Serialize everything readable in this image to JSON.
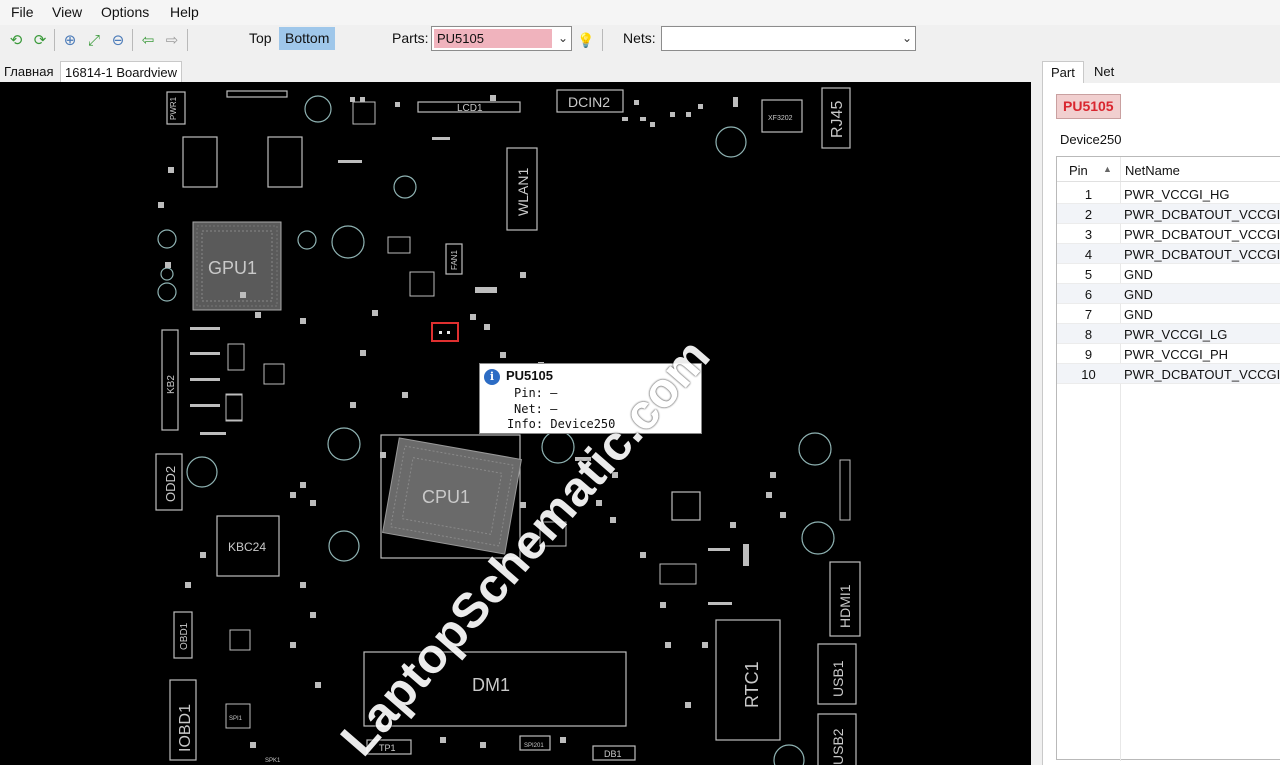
{
  "menu": [
    "File",
    "View",
    "Options",
    "Help"
  ],
  "toolbar": {
    "icons": [
      "rotate-left-icon",
      "rotate-right-icon",
      "zoom-in-icon",
      "zoom-fit-icon",
      "zoom-out-icon",
      "back-icon",
      "forward-icon"
    ],
    "top_label": "Top",
    "bottom_label": "Bottom",
    "parts_label": "Parts:",
    "parts_value": "PU5105",
    "nets_label": "Nets:",
    "nets_value": ""
  },
  "tabs": [
    "Главная",
    "16814-1 Boardview"
  ],
  "board": {
    "labels": [
      "PWR1",
      "LCD1",
      "DCIN2",
      "XF3202",
      "RJ45",
      "WLAN1",
      "GPU1",
      "FAN1",
      "KB2",
      "ODD2",
      "CPU1",
      "KBC24",
      "OBD1",
      "IOBD1",
      "DM1",
      "RTC1",
      "HDMI1",
      "USB1",
      "USB2",
      "TP1",
      "DB1",
      "SPI201",
      "SPK1",
      "SPI1"
    ],
    "selected_part": "PU5105"
  },
  "tooltip": {
    "title": "PU5105",
    "pin": "Pin: —",
    "net": "Net: —",
    "info": "Info: Device250"
  },
  "watermark": "LaptopSchematic.com",
  "panel": {
    "tabs": [
      "Part",
      "Net"
    ],
    "part_name": "PU5105",
    "device": "Device250",
    "headers": {
      "pin": "Pin",
      "net": "NetName"
    },
    "rows": [
      {
        "pin": "1",
        "net": "PWR_VCCGI_HG"
      },
      {
        "pin": "2",
        "net": "PWR_DCBATOUT_VCCGI"
      },
      {
        "pin": "3",
        "net": "PWR_DCBATOUT_VCCGI"
      },
      {
        "pin": "4",
        "net": "PWR_DCBATOUT_VCCGI"
      },
      {
        "pin": "5",
        "net": "GND"
      },
      {
        "pin": "6",
        "net": "GND"
      },
      {
        "pin": "7",
        "net": "GND"
      },
      {
        "pin": "8",
        "net": "PWR_VCCGI_LG"
      },
      {
        "pin": "9",
        "net": "PWR_VCCGI_PH"
      },
      {
        "pin": "10",
        "net": "PWR_DCBATOUT_VCCGI"
      }
    ]
  }
}
